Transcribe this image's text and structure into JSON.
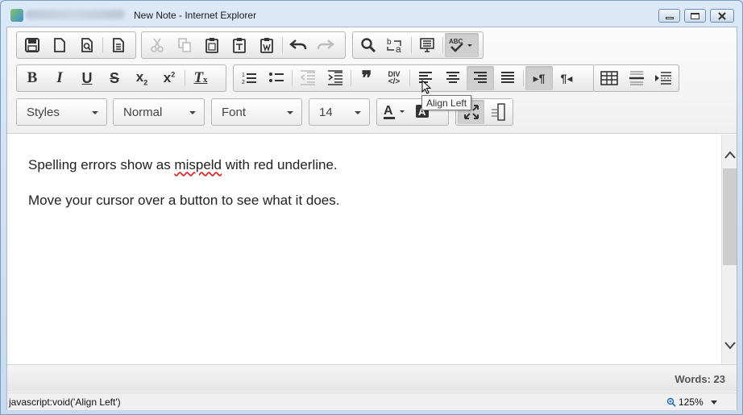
{
  "window": {
    "title": "New Note - Internet Explorer"
  },
  "toolbar": {
    "row1": [
      {
        "name": "save-icon",
        "glyph": "💾"
      },
      {
        "name": "new-page-icon",
        "glyph": "🗋"
      },
      {
        "name": "preview-icon",
        "glyph": "🔍"
      },
      {
        "name": "templates-icon",
        "glyph": "🗐"
      },
      {
        "name": "cut-icon",
        "glyph": "✂"
      },
      {
        "name": "copy-icon",
        "glyph": "⧉"
      },
      {
        "name": "paste-icon",
        "glyph": "📋"
      },
      {
        "name": "paste-text-icon",
        "glyph": "📋"
      },
      {
        "name": "paste-word-icon",
        "glyph": "📋"
      },
      {
        "name": "undo-icon",
        "glyph": "↶"
      },
      {
        "name": "redo-icon",
        "glyph": "↷"
      },
      {
        "name": "find-icon",
        "glyph": "🔍"
      },
      {
        "name": "replace-icon",
        "glyph": "b↔a"
      },
      {
        "name": "select-all-icon",
        "glyph": "▤"
      },
      {
        "name": "spellcheck-icon",
        "glyph": "ABC✓"
      }
    ],
    "row2": {
      "bold": "B",
      "italic": "I",
      "underline": "U",
      "strike": "S",
      "subscript": "x₂",
      "superscript": "x²",
      "remove_format": "Tx",
      "blockquote": "❞",
      "div": "DIV",
      "ltr": "▸¶",
      "rtl": "¶◂"
    },
    "styles_label": "Styles",
    "format_label": "Normal",
    "font_label": "Font",
    "size_label": "14"
  },
  "tooltip": "Align Left",
  "editor": {
    "line1_before": "Spelling errors show as ",
    "line1_misspelled": "mispeld",
    "line1_after": " with red underline.",
    "line2": "Move your cursor over a button to see what it does."
  },
  "word_count": "Words: 23",
  "status": {
    "text": "javascript:void('Align Left')",
    "zoom": "125%"
  }
}
